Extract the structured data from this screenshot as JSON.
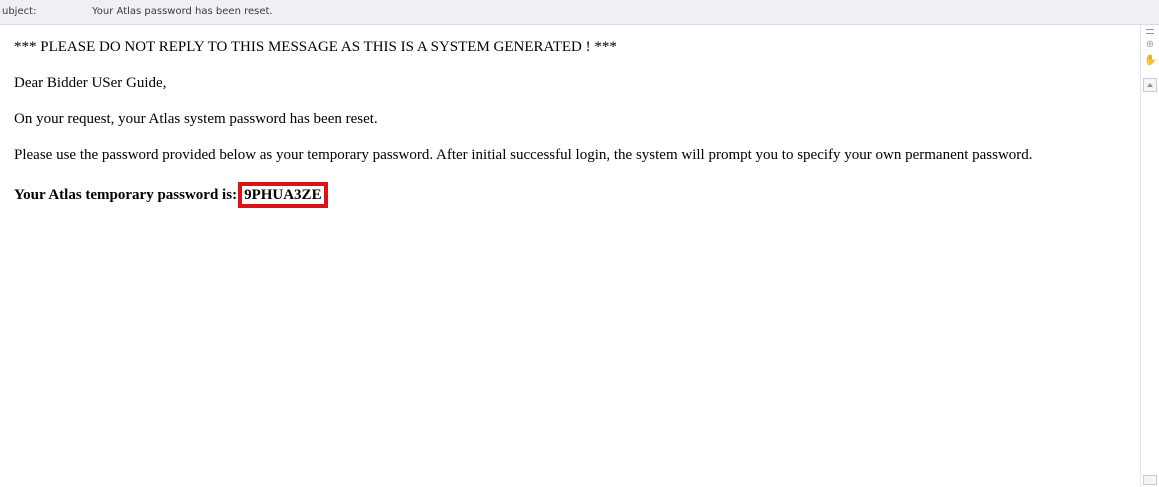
{
  "header": {
    "subject_label": "ubject:",
    "subject_value": "Your Atlas password has been reset."
  },
  "message": {
    "notice": "*** PLEASE DO NOT REPLY TO THIS MESSAGE AS THIS IS A SYSTEM GENERATED ! ***",
    "greeting": "Dear Bidder USer Guide,",
    "line1": "On your request, your Atlas system password has been reset.",
    "line2": "Please use the password provided below as your temporary password. After initial successful login, the system will prompt you to specify your own permanent password.",
    "password_label": "Your Atlas temporary password is:",
    "password_value": "9PHUA3ZE"
  },
  "highlight_color": "#d9131a",
  "scrollbar": {
    "icons": [
      "zoom-icon",
      "hand-icon"
    ]
  }
}
